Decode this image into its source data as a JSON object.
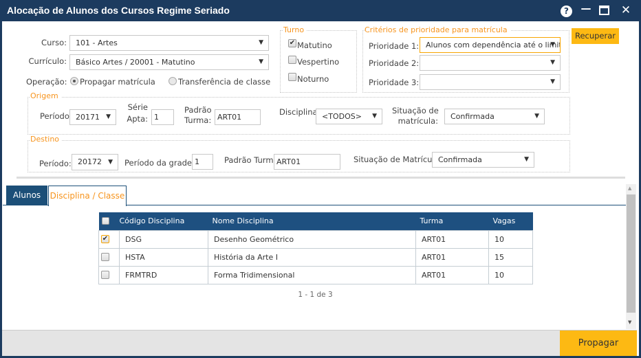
{
  "window": {
    "title": "Alocação de Alunos dos Cursos Regime Seriado",
    "icons": [
      "help-icon",
      "minimize-icon",
      "maximize-icon",
      "close-icon"
    ]
  },
  "form": {
    "curso_label": "Curso:",
    "curso_value": "101 - Artes",
    "curriculo_label": "Currículo:",
    "curriculo_value": "Básico Artes / 20001 - Matutino",
    "operacao_label": "Operação:",
    "operacao_options": [
      "Propagar matrícula",
      "Transferência de classe"
    ],
    "operacao_selected": "Propagar matrícula"
  },
  "turno": {
    "legend": "Turno",
    "options": [
      {
        "label": "Matutino",
        "checked": true
      },
      {
        "label": "Vespertino",
        "checked": false
      },
      {
        "label": "Noturno",
        "checked": false
      }
    ]
  },
  "criterios": {
    "legend": "Critérios de prioridade para matrícula",
    "items": [
      {
        "label": "Prioridade 1:",
        "value": "Alunos com dependência até o limite"
      },
      {
        "label": "Prioridade 2:",
        "value": ""
      },
      {
        "label": "Prioridade 3:",
        "value": ""
      }
    ]
  },
  "recuperar_label": "Recuperar",
  "origem": {
    "legend": "Origem",
    "periodo_label": "Período:",
    "periodo_value": "20171",
    "serie_label_1": "Série",
    "serie_label_2": "Apta:",
    "serie_value": "1",
    "padrao_label_1": "Padrão",
    "padrao_label_2": "Turma:",
    "padrao_value": "ART01",
    "disciplina_label": "Disciplina:",
    "disciplina_value": "<TODOS>",
    "situacao_label_1": "Situação de",
    "situacao_label_2": "matrícula:",
    "situacao_value": "Confirmada"
  },
  "destino": {
    "legend": "Destino",
    "periodo_label": "Período:",
    "periodo_value": "20172",
    "grade_label": "Período da grade:",
    "grade_value": "1",
    "padrao_label": "Padrão Turma:",
    "padrao_value": "ART01",
    "situacao_label": "Situação de Matrícula:",
    "situacao_value": "Confirmada"
  },
  "tabs": [
    {
      "label": "Alunos",
      "active": false
    },
    {
      "label": "Disciplina / Classe",
      "active": true
    }
  ],
  "table": {
    "columns": [
      "Código Disciplina",
      "Nome Disciplina",
      "Turma",
      "Vagas"
    ],
    "rows": [
      {
        "checked": true,
        "codigo": "DSG",
        "nome": "Desenho Geométrico",
        "turma": "ART01",
        "vagas": "10"
      },
      {
        "checked": false,
        "codigo": "HSTA",
        "nome": "História da Arte I",
        "turma": "ART01",
        "vagas": "15"
      },
      {
        "checked": false,
        "codigo": "FRMTRD",
        "nome": "Forma Tridimensional",
        "turma": "ART01",
        "vagas": "10"
      }
    ]
  },
  "pagination": "1 - 1 de 3",
  "propagar_label": "Propagar",
  "colors": {
    "header": "#1c3b5f",
    "accent": "#f7941d",
    "button": "#fdb913",
    "table_header": "#1e5080"
  }
}
